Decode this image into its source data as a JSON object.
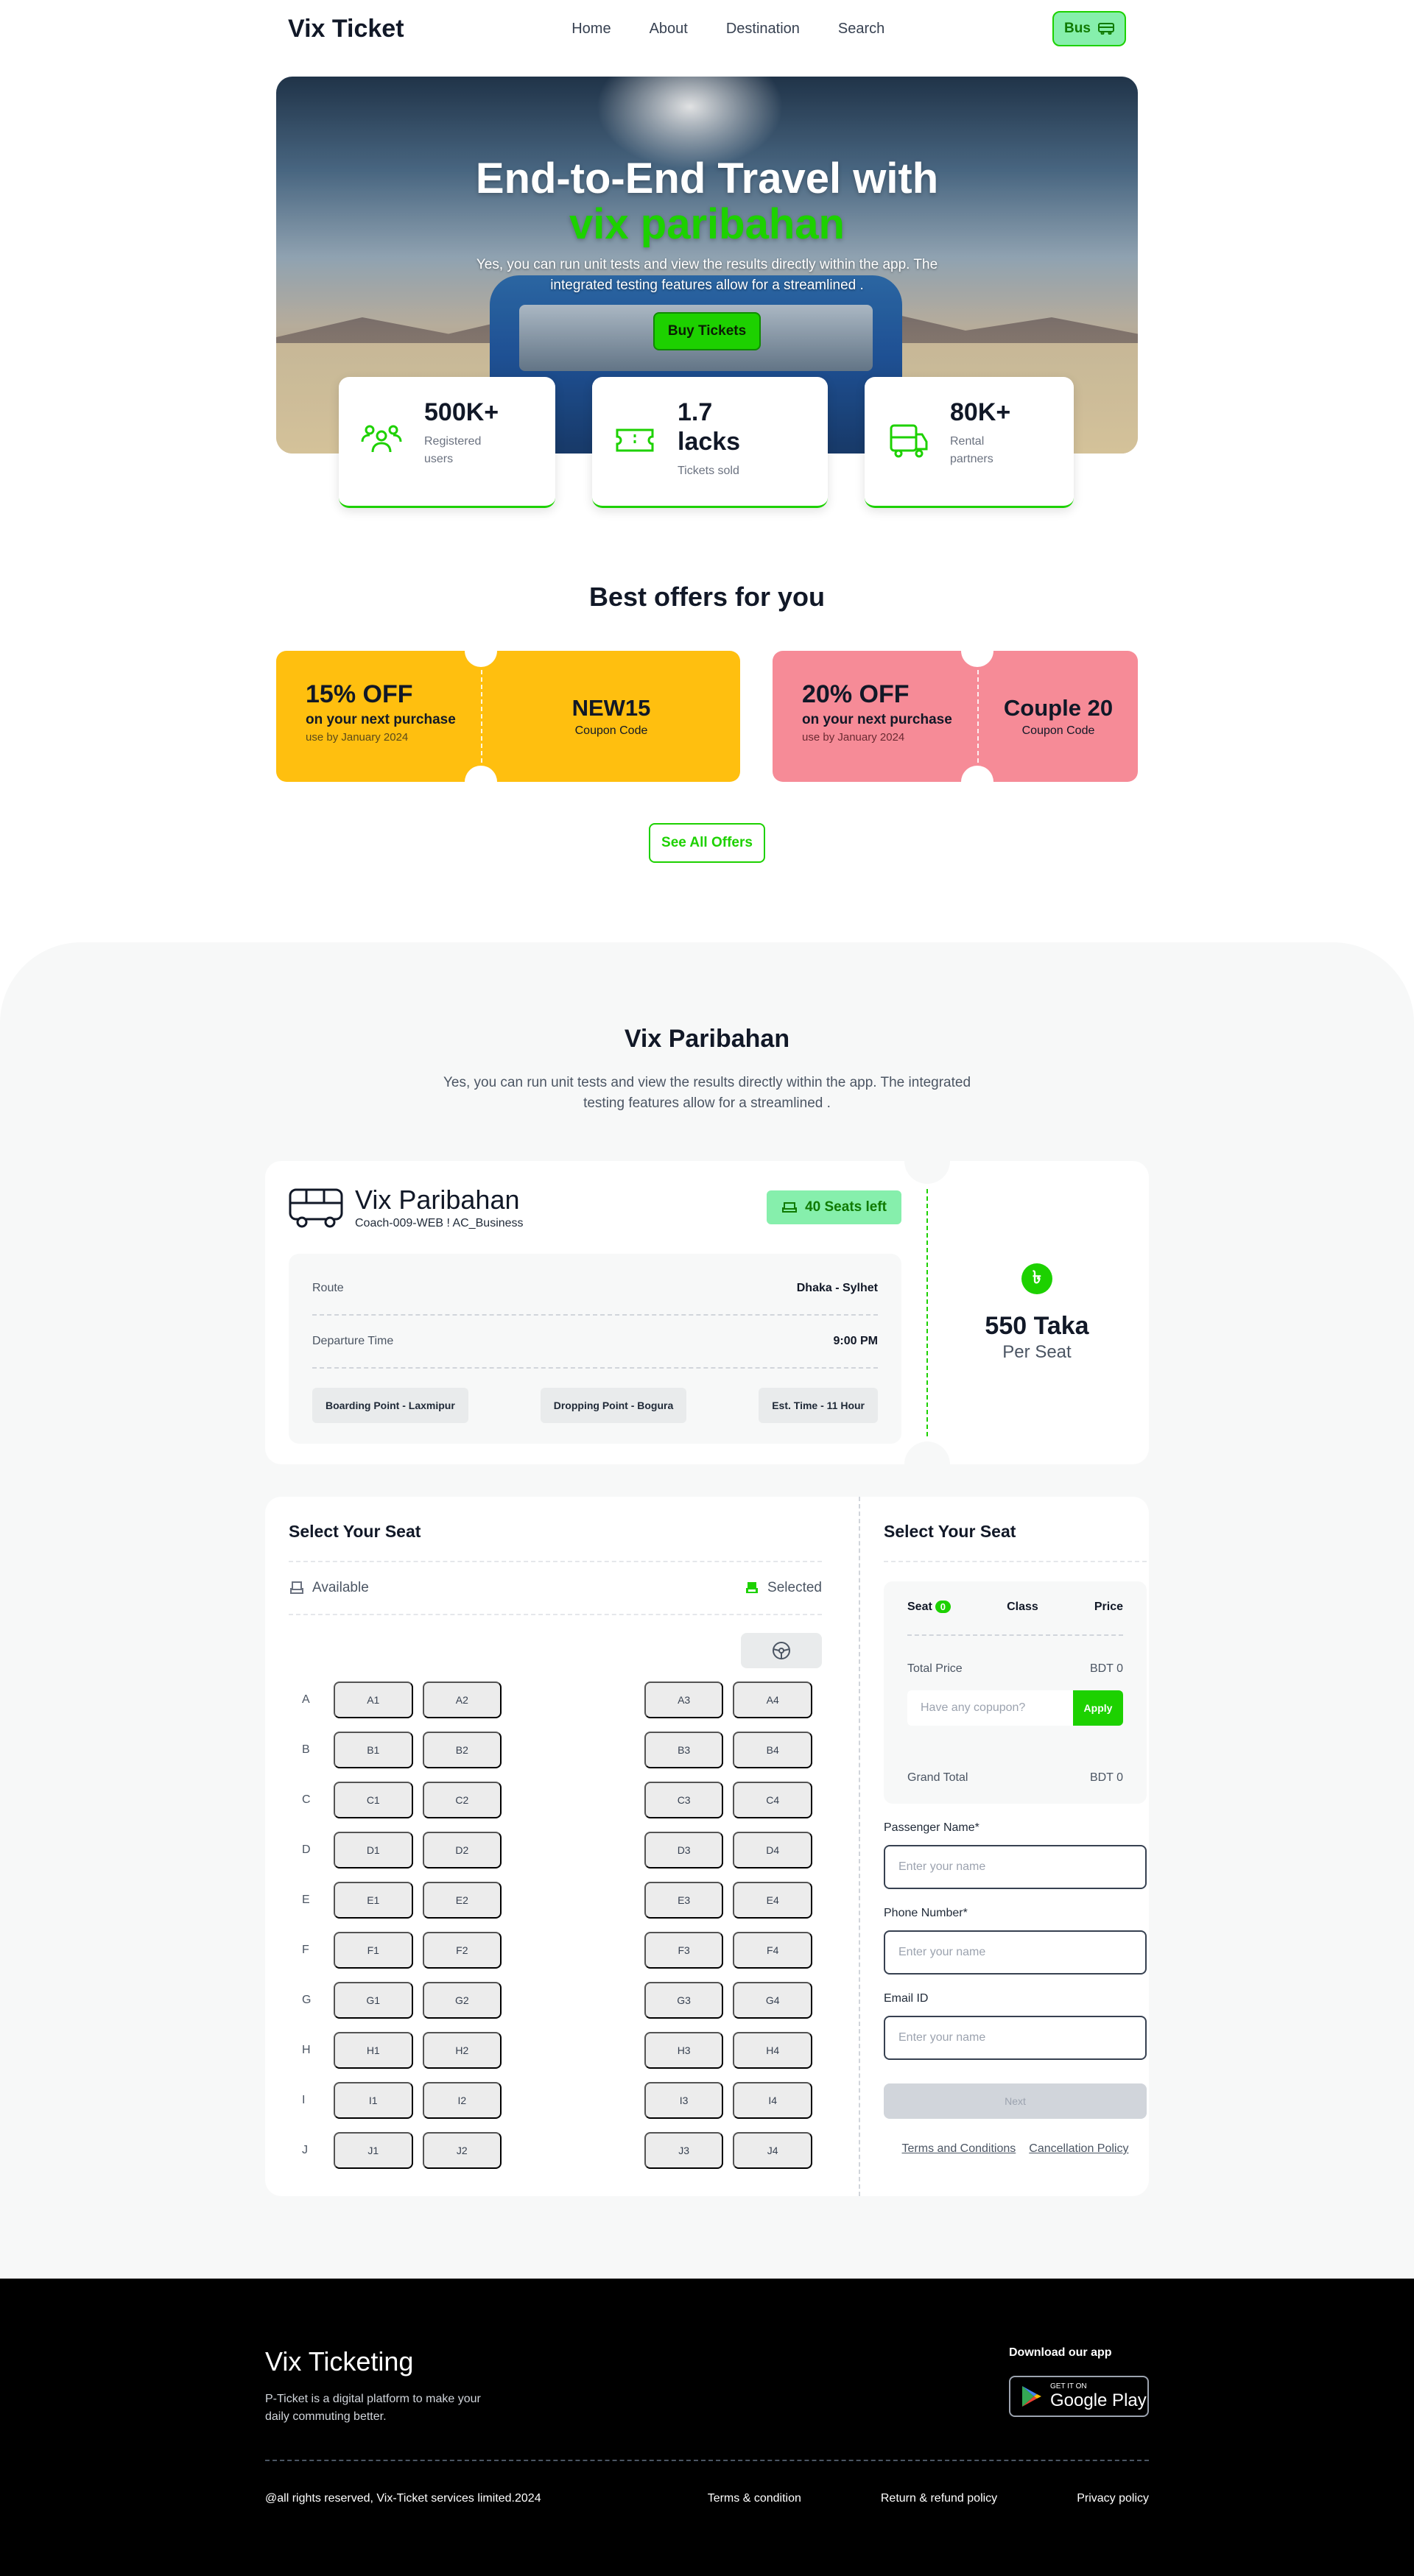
{
  "nav": {
    "logo": "Vix Ticket",
    "links": [
      "Home",
      "About",
      "Destination",
      "Search"
    ],
    "bus_button": "Bus"
  },
  "hero": {
    "title_line1": "End-to-End Travel with",
    "title_accent": "vix paribahan",
    "subtitle": "Yes, you can run unit tests and view the results directly within the app. The integrated testing features allow for a streamlined .",
    "buy_button": "Buy Tickets"
  },
  "stats": [
    {
      "value": "500K+",
      "label": "Registered users",
      "icon": "users-icon"
    },
    {
      "value": "1.7 lacks",
      "label": "Tickets sold",
      "icon": "ticket-icon"
    },
    {
      "value": "80K+",
      "label": "Rental partners",
      "icon": "bus-front-icon"
    }
  ],
  "offers": {
    "title": "Best offers for you",
    "items": [
      {
        "percent": "15% OFF",
        "desc": "on your next purchase",
        "until": "use by January 2024",
        "code": "NEW15",
        "code_label": "Coupon Code",
        "color": "#FFBF0F"
      },
      {
        "percent": "20% OFF",
        "desc": "on your next purchase",
        "until": "use by January 2024",
        "code": "Couple 20",
        "code_label": "Coupon Code",
        "color": "#F68B97"
      }
    ],
    "see_all": "See All Offers"
  },
  "paribahan": {
    "title": "Vix Paribahan",
    "subtitle": "Yes, you can run unit tests and view the results directly within the app. The integrated testing features allow for a streamlined .",
    "bus_name": "Vix Paribahan",
    "coach": "Coach-009-WEB ! AC_Business",
    "seats_left": "40  Seats left",
    "route_label": "Route",
    "route_value": "Dhaka - Sylhet",
    "departure_label": "Departure Time",
    "departure_value": "9:00 PM",
    "boarding": "Boarding Point - Laxmipur",
    "dropping": "Dropping Point - Bogura",
    "est_time": "Est. Time - 11 Hour",
    "price": "550 Taka",
    "per_seat": "Per Seat",
    "currency_symbol": "৳"
  },
  "seat_select": {
    "title": "Select Your Seat",
    "available": "Available",
    "selected": "Selected",
    "rows": [
      "A",
      "B",
      "C",
      "D",
      "E",
      "F",
      "G",
      "H",
      "I",
      "J"
    ]
  },
  "summary": {
    "title": "Select Your Seat",
    "col_seat": "Seat",
    "seat_count": "0",
    "col_class": "Class",
    "col_price": "Price",
    "total_label": "Total Price",
    "total_value": "BDT 0",
    "coupon_placeholder": "Have any copupon?",
    "apply": "Apply",
    "grand_label": "Grand Total",
    "grand_value": "BDT 0",
    "name_label": "Passenger Name*",
    "name_placeholder": "Enter your name",
    "phone_label": "Phone Number*",
    "phone_placeholder": "Enter your name",
    "email_label": "Email ID",
    "email_placeholder": "Enter your name",
    "next": "Next",
    "terms": "Terms and Conditions",
    "cancel_policy": "Cancellation Policy"
  },
  "footer": {
    "brand": "Vix Ticketing",
    "desc": "P-Ticket is a digital platform to make your daily commuting better.",
    "download": "Download our app",
    "gplay_small": "GET IT ON",
    "gplay_big": "Google Play",
    "copyright": "@all rights reserved, Vix-Ticket services limited.2024",
    "links": [
      "Terms & condition",
      "Return & refund policy",
      "Privacy policy"
    ]
  }
}
